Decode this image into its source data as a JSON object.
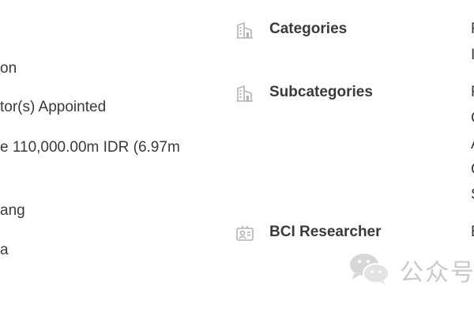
{
  "left_column": {
    "line_1": "on",
    "line_2": "tor(s) Appointed",
    "line_3": "e 110,000.00m IDR (6.97m",
    "line_4": "ang",
    "line_5": "a"
  },
  "right_column": {
    "categories": {
      "icon": "building-icon",
      "label": "Categories",
      "value_fragments": [
        "F",
        "I"
      ]
    },
    "subcategories": {
      "icon": "building-icon",
      "label": "Subcategories",
      "value_fragments": [
        "F",
        "C",
        "A",
        "C",
        "S"
      ]
    },
    "researcher": {
      "icon": "researcher-id-icon",
      "label": "BCI Researcher",
      "value_fragments": [
        "E"
      ]
    }
  },
  "watermark": {
    "icon": "wechat-icon",
    "text": "公众号"
  },
  "colors": {
    "text": "#3a3a3a",
    "icon": "#b3b3b3",
    "watermark": "#c9c9c9"
  }
}
